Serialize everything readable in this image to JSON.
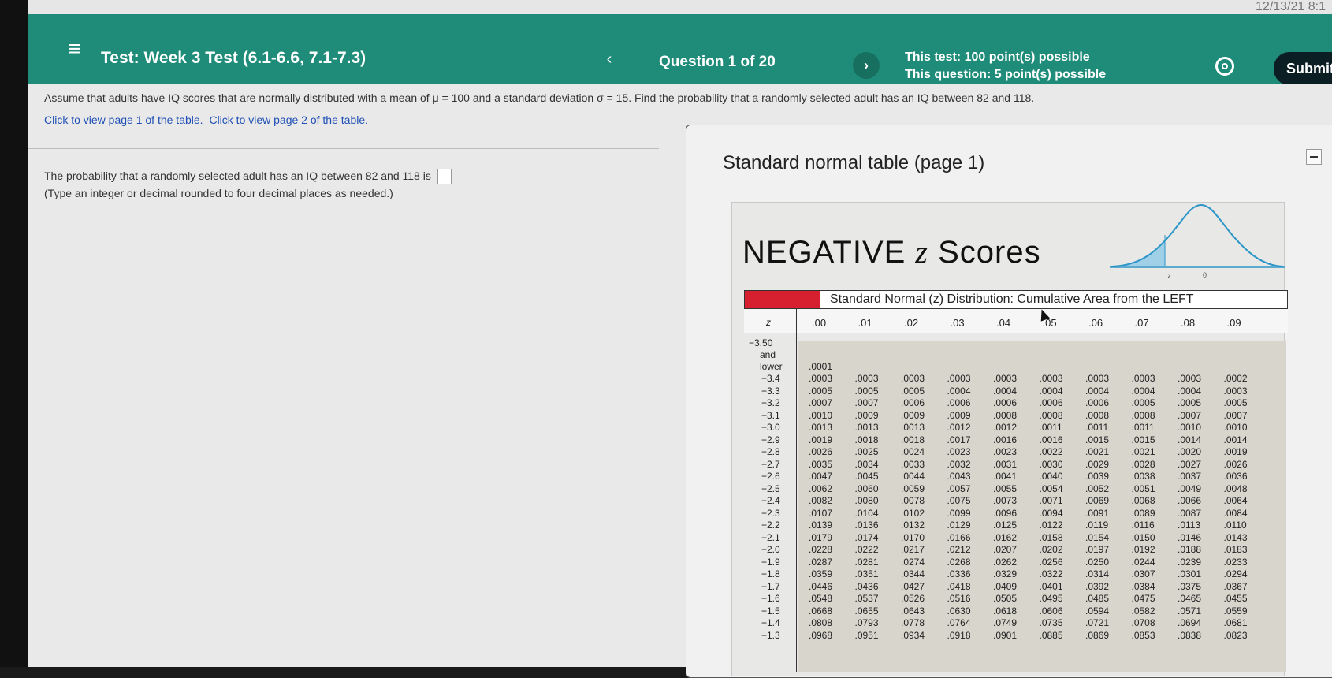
{
  "clock": "12/13/21 8:1",
  "header": {
    "title": "Test: Week 3 Test (6.1-6.6, 7.1-7.3)",
    "prev": "‹",
    "question_counter": "Question 1 of 20",
    "next": "›",
    "test_points": "This test: 100 point(s) possible",
    "question_points": "This question: 5 point(s) possible",
    "submit": "Submit tes"
  },
  "question": {
    "text": "Assume that adults have IQ scores that are normally distributed with a mean of μ = 100 and a standard deviation σ = 15. Find the probability that a randomly selected adult has an IQ between 82 and 118.",
    "link1": "Click to view page 1 of the table.",
    "link2": "Click to view page 2 of the table.",
    "answer_line1": "The probability that a randomly selected adult has an IQ between 82 and 118 is",
    "answer_line2": "(Type an integer or decimal rounded to four decimal places as needed.)"
  },
  "popup": {
    "title": "Standard normal table (page 1)",
    "heading_word": "NEGATIVE",
    "heading_z": "z",
    "heading_tail": "Scores",
    "curve_z": "z",
    "curve_zero": "0",
    "table_caption": "Standard Normal (z) Distribution: Cumulative Area from the LEFT",
    "z_header": "z",
    "columns": [
      ".00",
      ".01",
      ".02",
      ".03",
      ".04",
      ".05",
      ".06",
      ".07",
      ".08",
      ".09"
    ],
    "lower_label": [
      "−3.50",
      "and",
      "lower"
    ],
    "lower_value": ".0001",
    "rows": [
      {
        "z": "−3.4",
        "v": [
          ".0003",
          ".0003",
          ".0003",
          ".0003",
          ".0003",
          ".0003",
          ".0003",
          ".0003",
          ".0003",
          ".0002"
        ]
      },
      {
        "z": "−3.3",
        "v": [
          ".0005",
          ".0005",
          ".0005",
          ".0004",
          ".0004",
          ".0004",
          ".0004",
          ".0004",
          ".0004",
          ".0003"
        ]
      },
      {
        "z": "−3.2",
        "v": [
          ".0007",
          ".0007",
          ".0006",
          ".0006",
          ".0006",
          ".0006",
          ".0006",
          ".0005",
          ".0005",
          ".0005"
        ]
      },
      {
        "z": "−3.1",
        "v": [
          ".0010",
          ".0009",
          ".0009",
          ".0009",
          ".0008",
          ".0008",
          ".0008",
          ".0008",
          ".0007",
          ".0007"
        ]
      },
      {
        "z": "−3.0",
        "v": [
          ".0013",
          ".0013",
          ".0013",
          ".0012",
          ".0012",
          ".0011",
          ".0011",
          ".0011",
          ".0010",
          ".0010"
        ]
      },
      {
        "z": "−2.9",
        "v": [
          ".0019",
          ".0018",
          ".0018",
          ".0017",
          ".0016",
          ".0016",
          ".0015",
          ".0015",
          ".0014",
          ".0014"
        ]
      },
      {
        "z": "−2.8",
        "v": [
          ".0026",
          ".0025",
          ".0024",
          ".0023",
          ".0023",
          ".0022",
          ".0021",
          ".0021",
          ".0020",
          ".0019"
        ]
      },
      {
        "z": "−2.7",
        "v": [
          ".0035",
          ".0034",
          ".0033",
          ".0032",
          ".0031",
          ".0030",
          ".0029",
          ".0028",
          ".0027",
          ".0026"
        ]
      },
      {
        "z": "−2.6",
        "v": [
          ".0047",
          ".0045",
          ".0044",
          ".0043",
          ".0041",
          ".0040",
          ".0039",
          ".0038",
          ".0037",
          ".0036"
        ]
      },
      {
        "z": "−2.5",
        "v": [
          ".0062",
          ".0060",
          ".0059",
          ".0057",
          ".0055",
          ".0054",
          ".0052",
          ".0051",
          ".0049",
          ".0048"
        ]
      },
      {
        "z": "−2.4",
        "v": [
          ".0082",
          ".0080",
          ".0078",
          ".0075",
          ".0073",
          ".0071",
          ".0069",
          ".0068",
          ".0066",
          ".0064"
        ]
      },
      {
        "z": "−2.3",
        "v": [
          ".0107",
          ".0104",
          ".0102",
          ".0099",
          ".0096",
          ".0094",
          ".0091",
          ".0089",
          ".0087",
          ".0084"
        ]
      },
      {
        "z": "−2.2",
        "v": [
          ".0139",
          ".0136",
          ".0132",
          ".0129",
          ".0125",
          ".0122",
          ".0119",
          ".0116",
          ".0113",
          ".0110"
        ]
      },
      {
        "z": "−2.1",
        "v": [
          ".0179",
          ".0174",
          ".0170",
          ".0166",
          ".0162",
          ".0158",
          ".0154",
          ".0150",
          ".0146",
          ".0143"
        ]
      },
      {
        "z": "−2.0",
        "v": [
          ".0228",
          ".0222",
          ".0217",
          ".0212",
          ".0207",
          ".0202",
          ".0197",
          ".0192",
          ".0188",
          ".0183"
        ]
      },
      {
        "z": "−1.9",
        "v": [
          ".0287",
          ".0281",
          ".0274",
          ".0268",
          ".0262",
          ".0256",
          ".0250",
          ".0244",
          ".0239",
          ".0233"
        ]
      },
      {
        "z": "−1.8",
        "v": [
          ".0359",
          ".0351",
          ".0344",
          ".0336",
          ".0329",
          ".0322",
          ".0314",
          ".0307",
          ".0301",
          ".0294"
        ]
      },
      {
        "z": "−1.7",
        "v": [
          ".0446",
          ".0436",
          ".0427",
          ".0418",
          ".0409",
          ".0401",
          ".0392",
          ".0384",
          ".0375",
          ".0367"
        ]
      },
      {
        "z": "−1.6",
        "v": [
          ".0548",
          ".0537",
          ".0526",
          ".0516",
          ".0505",
          ".0495",
          ".0485",
          ".0475",
          ".0465",
          ".0455"
        ]
      },
      {
        "z": "−1.5",
        "v": [
          ".0668",
          ".0655",
          ".0643",
          ".0630",
          ".0618",
          ".0606",
          ".0594",
          ".0582",
          ".0571",
          ".0559"
        ]
      },
      {
        "z": "−1.4",
        "v": [
          ".0808",
          ".0793",
          ".0778",
          ".0764",
          ".0749",
          ".0735",
          ".0721",
          ".0708",
          ".0694",
          ".0681"
        ]
      },
      {
        "z": "−1.3",
        "v": [
          ".0968",
          ".0951",
          ".0934",
          ".0918",
          ".0901",
          ".0885",
          ".0869",
          ".0853",
          ".0838",
          ".0823"
        ]
      }
    ]
  }
}
